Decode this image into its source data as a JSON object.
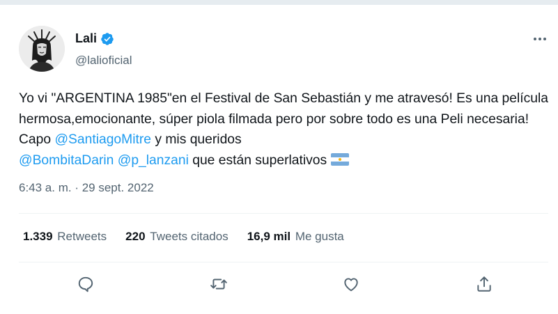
{
  "tweet": {
    "author": {
      "name": "Lali",
      "handle": "@lalioficial",
      "verified": true,
      "avatar_icon": "avatar-image"
    },
    "body": {
      "text_1": "Yo vi \"ARGENTINA 1985\"en el Festival de San Sebastián y me atravesó! Es una película hermosa,emocionante, súper piola filmada pero por sobre todo es una Peli necesaria! Capo ",
      "mention_1": "@SantiagoMitre",
      "text_2": " y mis queridos ",
      "mention_2": "@BombitaDarin",
      "text_3": " ",
      "mention_3": "@p_lanzani",
      "text_4": " que están superlativos ",
      "emoji": "argentina-flag-icon"
    },
    "timestamp": "6:43 a. m. · 29 sept. 2022",
    "stats": {
      "retweets_count": "1.339",
      "retweets_label": "Retweets",
      "quotes_count": "220",
      "quotes_label": "Tweets citados",
      "likes_count": "16,9 mil",
      "likes_label": "Me gusta"
    },
    "actions": [
      "reply-icon",
      "retweet-icon",
      "like-icon",
      "share-icon"
    ]
  },
  "colors": {
    "accent": "#1d9bf0",
    "text": "#0f1419",
    "secondary_text": "#536471",
    "divider": "#eff3f4"
  }
}
